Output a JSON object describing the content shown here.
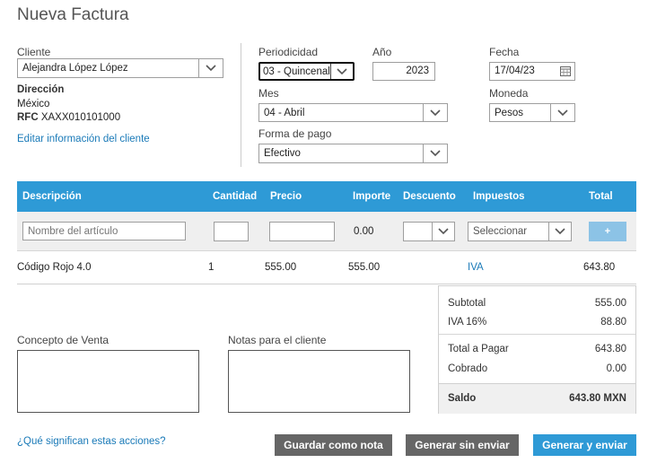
{
  "page": {
    "title": "Nueva Factura"
  },
  "client": {
    "label": "Cliente",
    "value": "Alejandra López López",
    "address_label": "Dirección",
    "country": "México",
    "rfc_label": "RFC",
    "rfc": "XAXX010101000",
    "edit_link": "Editar información del cliente"
  },
  "periodicity": {
    "label": "Periodicidad",
    "value": "03 - Quincenal"
  },
  "year": {
    "label": "Año",
    "value": "2023"
  },
  "date": {
    "label": "Fecha",
    "value": "17/04/23"
  },
  "month": {
    "label": "Mes",
    "value": "04 - Abril"
  },
  "currency": {
    "label": "Moneda",
    "value": "Pesos"
  },
  "payment": {
    "label": "Forma de pago",
    "value": "Efectivo"
  },
  "table": {
    "headers": {
      "description": "Descripción",
      "quantity": "Cantidad",
      "price": "Precio",
      "amount": "Importe",
      "discount": "Descuento",
      "taxes": "Impuestos",
      "total": "Total"
    },
    "entry": {
      "name_placeholder": "Nombre del artículo",
      "amount": "0.00",
      "taxes_placeholder": "Seleccionar",
      "add_label": "+"
    },
    "rows": [
      {
        "description": "Código Rojo 4.0",
        "quantity": "1",
        "price": "555.00",
        "amount": "555.00",
        "taxes": "IVA",
        "total": "643.80"
      }
    ]
  },
  "summary": {
    "subtotal_label": "Subtotal",
    "subtotal": "555.00",
    "iva_label": "IVA 16%",
    "iva": "88.80",
    "total_label": "Total a Pagar",
    "total": "643.80",
    "paid_label": "Cobrado",
    "paid": "0.00",
    "balance_label": "Saldo",
    "balance": "643.80 MXN"
  },
  "concept": {
    "label": "Concepto de Venta"
  },
  "notes": {
    "label": "Notas para el cliente"
  },
  "footer": {
    "help_link": "¿Qué significan estas acciones?",
    "save_note": "Guardar como nota",
    "generate_no_send": "Generar sin enviar",
    "generate_send": "Generar y enviar"
  },
  "colors": {
    "accent": "#2e9ad6",
    "link": "#1a7ab8",
    "button_gray": "#666666"
  },
  "icons": {
    "dropdown": "chevron-down-icon",
    "calendar": "calendar-icon"
  }
}
